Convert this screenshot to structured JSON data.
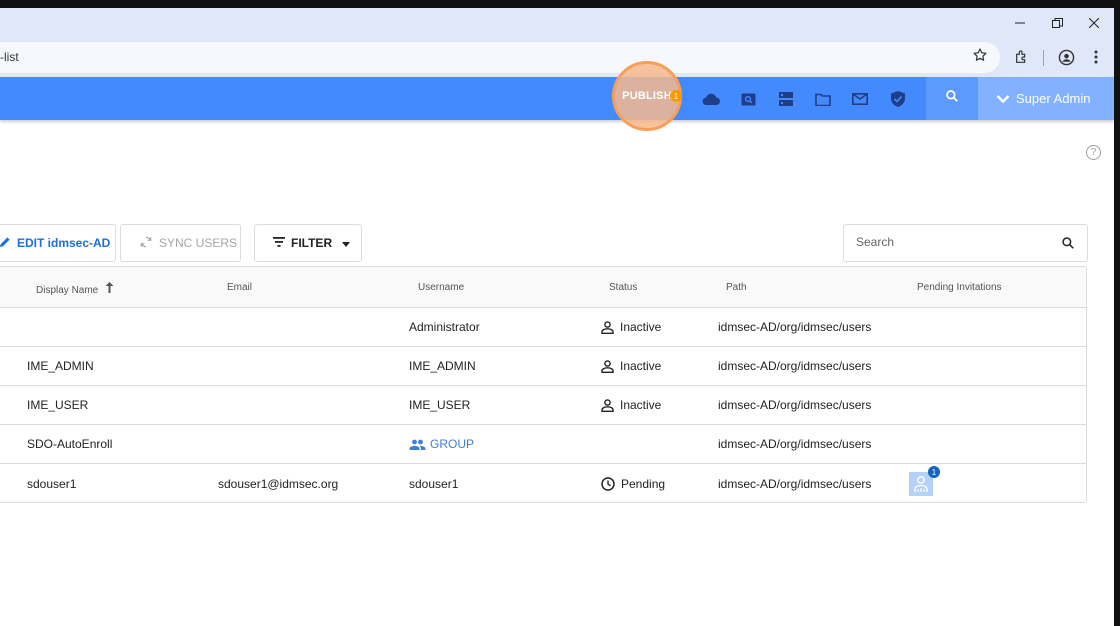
{
  "browser": {
    "url": "-list"
  },
  "appbar": {
    "publish_label": "PUBLISH",
    "publish_badge": "1",
    "user_label": "Super Admin",
    "icons": [
      "cloud-icon",
      "search-box-icon",
      "server-icon",
      "folder-icon",
      "mail-icon",
      "shield-check-icon"
    ]
  },
  "help": "?",
  "toolbar": {
    "edit_label": "EDIT idmsec-AD",
    "sync_label": "SYNC USERS",
    "filter_label": "FILTER",
    "search_placeholder": "Search"
  },
  "table": {
    "headers": {
      "display_name": "Display Name",
      "email": "Email",
      "username": "Username",
      "status": "Status",
      "path": "Path",
      "pending": "Pending Invitations"
    },
    "rows": [
      {
        "display_name": "",
        "email": "",
        "username": "Administrator",
        "status": "Inactive",
        "path": "idmsec-AD/org/idmsec/users"
      },
      {
        "display_name": "IME_ADMIN",
        "email": "",
        "username": "IME_ADMIN",
        "status": "Inactive",
        "path": "idmsec-AD/org/idmsec/users"
      },
      {
        "display_name": "IME_USER",
        "email": "",
        "username": "IME_USER",
        "status": "Inactive",
        "path": "idmsec-AD/org/idmsec/users"
      },
      {
        "display_name": "SDO-AutoEnroll",
        "email": "",
        "username": "GROUP",
        "status": "",
        "path": "idmsec-AD/org/idmsec/users"
      },
      {
        "display_name": "sdouser1",
        "email": "sdouser1@idmsec.org",
        "username": "sdouser1",
        "status": "Pending",
        "path": "idmsec-AD/org/idmsec/users",
        "pending_count": "1"
      }
    ]
  },
  "colors": {
    "appbar": "#448aff",
    "link": "#3f7fd6",
    "publish_ring": "#f5a05a"
  }
}
